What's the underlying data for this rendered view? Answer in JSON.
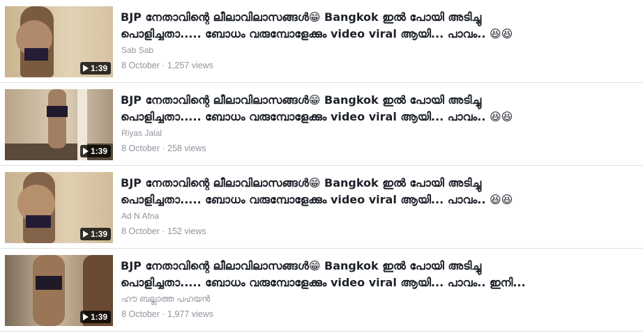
{
  "videos": [
    {
      "title_line1": "BJP നേതാവിന്റെ ലീലാവിലാസങ്ങൾ😁 Bangkok ഇൽ പോയി അടിച്ചു",
      "title_line2": "പൊളിച്ചതാ..... ബോധം വരുമ്പോളേക്കും video viral ആയി... പാവം.. 😆😆",
      "author": "Sab Sab",
      "date": "8 October",
      "separator": " · ",
      "views": "1,257 views",
      "duration": "1:39"
    },
    {
      "title_line1": "BJP നേതാവിന്റെ ലീലാവിലാസങ്ങൾ😁 Bangkok ഇൽ പോയി അടിച്ചു",
      "title_line2": "പൊളിച്ചതാ..... ബോധം വരുമ്പോളേക്കും video viral ആയി... പാവം.. 😆😆",
      "author": "Riyas Jalal",
      "date": "8 October",
      "separator": " · ",
      "views": "258 views",
      "duration": "1:39"
    },
    {
      "title_line1": "BJP നേതാവിന്റെ ലീലാവിലാസങ്ങൾ😁 Bangkok ഇൽ പോയി അടിച്ചു",
      "title_line2": "പൊളിച്ചതാ..... ബോധം വരുമ്പോളേക്കും video viral ആയി... പാവം.. 😆😆",
      "author": "Ad N Afna",
      "date": "8 October",
      "separator": " · ",
      "views": "152 views",
      "duration": "1:39"
    },
    {
      "title_line1": "BJP നേതാവിന്റെ ലീലാവിലാസങ്ങൾ😁 Bangkok ഇൽ പോയി അടിച്ചു",
      "title_line2": "പൊളിച്ചതാ..... ബോധം വരുമ്പോളേക്കും video viral ആയി... പാവം.. ഇനി...",
      "author": "ഹൗ ബല്ലാത്ത പഹയൻ",
      "date": "8 October",
      "separator": " · ",
      "views": "1,977 views",
      "duration": "1:39"
    }
  ],
  "icons": {
    "play": "play-icon"
  },
  "colors": {
    "title": "#1d2129",
    "meta": "#90949c",
    "divider": "#dddfe2"
  }
}
